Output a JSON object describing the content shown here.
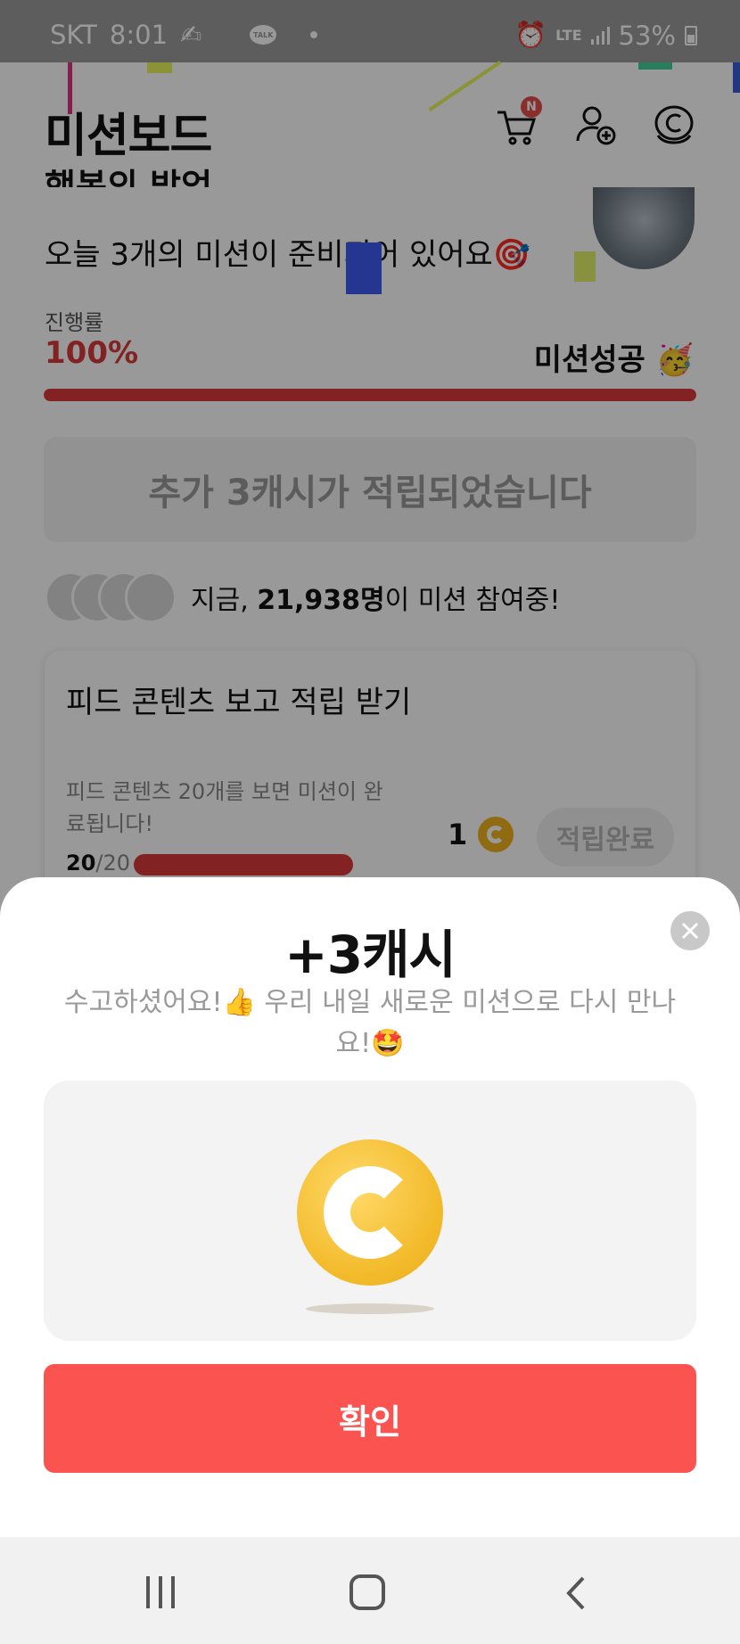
{
  "status_bar": {
    "carrier": "SKT",
    "time": "8:01",
    "talk_label": "TALK",
    "network": "LTE",
    "battery": "53%"
  },
  "header": {
    "title": "미션보드",
    "cart_badge": "N"
  },
  "greeting": {
    "line1": "행복의 밤엄,",
    "line2": "오늘 3개의 미션이 준비되어 있어요🎯"
  },
  "progress": {
    "label": "진행률",
    "value": "100%",
    "fraction": 1.0,
    "success_text": "미션성공 🥳"
  },
  "bonus_banner": "추가 3캐시가 적립되었습니다",
  "participants": {
    "prefix": "지금, ",
    "count": "21,938명",
    "suffix": "이 미션 참여중!"
  },
  "mission": {
    "title": "피드 콘텐츠 보고 적립 받기",
    "description": "피드 콘텐츠 20개를 보면 미션이 완료됩니다!",
    "done": "20",
    "total": "/20",
    "reward": "1",
    "button_label": "적립완료"
  },
  "sheet": {
    "title": "+3캐시",
    "message": "수고하셨어요!👍 우리 내일 새로운 미션으로 다시 만나요!🤩",
    "confirm_label": "확인"
  },
  "colors": {
    "accent_red": "#d93a3a",
    "confirm_red": "#fb5350",
    "coin_gold": "#f3bb2c"
  }
}
